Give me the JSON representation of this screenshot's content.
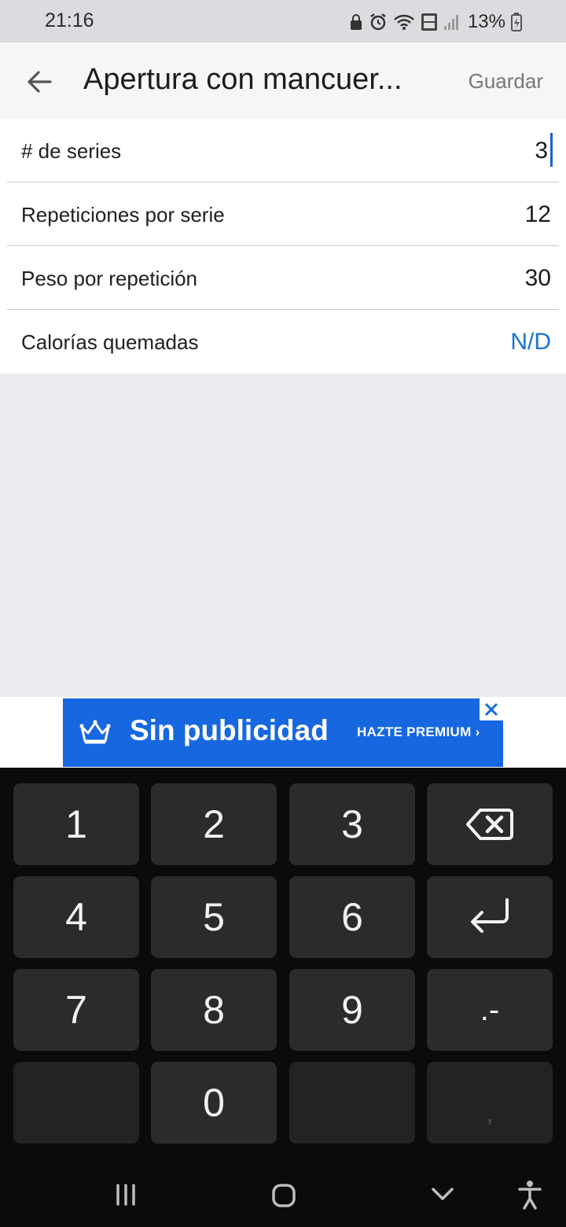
{
  "status": {
    "time": "21:16",
    "battery": "13%"
  },
  "appbar": {
    "title": "Apertura con mancuer...",
    "save": "Guardar"
  },
  "form": {
    "rows": [
      {
        "label": "# de series",
        "value": "3"
      },
      {
        "label": "Repeticiones por serie",
        "value": "12"
      },
      {
        "label": "Peso por repetición",
        "value": "30"
      },
      {
        "label": "Calorías quemadas",
        "value": "N/D"
      }
    ]
  },
  "ad": {
    "title": "Sin publicidad",
    "cta": "HAZTE PREMIUM  ›"
  },
  "keyboard": {
    "keys": [
      "1",
      "2",
      "3",
      "4",
      "5",
      "6",
      "7",
      "8",
      "9",
      ".-",
      "0",
      ","
    ]
  },
  "colors": {
    "accent": "#1a73d6",
    "ad_bg": "#1667e0",
    "keyboard_bg": "#0b0b0b"
  }
}
